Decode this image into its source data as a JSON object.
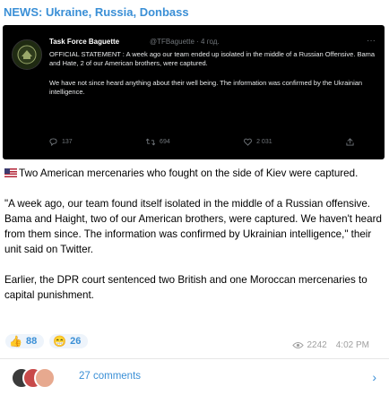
{
  "channel": {
    "name": "NEWS: Ukraine, Russia, Donbass"
  },
  "tweet": {
    "author": "Task Force Baguette",
    "handle": "@TFBaguette · 4 год.",
    "paragraphs": [
      "OFFICIAL STATEMENT : A week ago our team ended up isolated in the middle of a Russian Offensive. Bama and Hate, 2 of our American brothers, were captured.",
      "We have not since heard anything about their well being. The information was confirmed by the Ukrainian intelligence."
    ],
    "replies": "137",
    "retweets": "694",
    "likes": "2 031"
  },
  "post": {
    "flag_icon": "us-flag-icon",
    "paragraphs": [
      "Two American mercenaries who fought on the side of Kiev were captured.",
      "\"A week ago, our team found itself isolated in the middle of a Russian offensive. Bama and Haight, two of our American brothers, were captured. We haven't heard from them since. The information was confirmed by Ukrainian intelligence,\" their unit said on Twitter.",
      "Earlier, the DPR court sentenced two British and one Moroccan mercenaries to capital punishment."
    ]
  },
  "reactions": [
    {
      "emoji": "👍",
      "count": "88"
    },
    {
      "emoji": "😁",
      "count": "26"
    }
  ],
  "meta": {
    "views": "2242",
    "time": "4:02 PM"
  },
  "comments": {
    "label": "27 comments"
  },
  "colors": {
    "accent": "#3a8fd6",
    "tweet_bg": "#000000"
  }
}
